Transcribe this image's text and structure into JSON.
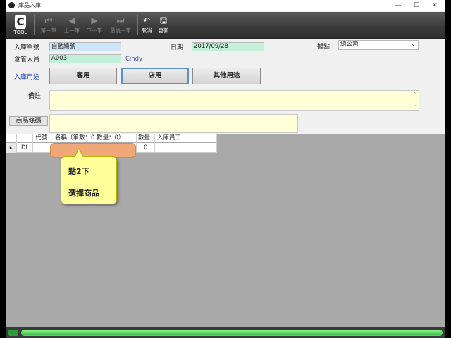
{
  "window": {
    "title": "庫品入庫",
    "minimize": "—",
    "maximize": "☐",
    "close": "✕"
  },
  "toolbar": {
    "logo_letter": "C",
    "logo_text": "TOOL",
    "buttons": [
      {
        "icon": "⏮",
        "label": "第一筆"
      },
      {
        "icon": "◀",
        "label": "上一筆"
      },
      {
        "icon": "▶",
        "label": "下一筆"
      },
      {
        "icon": "⏭",
        "label": "最後一筆"
      },
      {
        "icon": "↶",
        "label": "取消"
      },
      {
        "icon": "🖫",
        "label": "更新"
      }
    ]
  },
  "form": {
    "order_no_label": "入庫單號",
    "order_no_value": "自動編號",
    "date_label": "日期",
    "date_value": "2017/09/28",
    "location_label": "據點",
    "location_value": "總公司",
    "keeper_label": "倉管人員",
    "keeper_value": "A003",
    "keeper_name": "Cindy",
    "purpose_link": "入庫用途",
    "purpose_buttons": [
      "客用",
      "店用",
      "其他用途"
    ],
    "memo_label": "備註",
    "barcode_button": "商品條碼"
  },
  "grid": {
    "headers": [
      "代號",
      "名稱（筆數：0 數量：0）",
      "數量",
      "入庫員工"
    ],
    "row_marker": "▸",
    "rows": [
      {
        "code": "DL",
        "name": "",
        "qty": "0",
        "staff": ""
      }
    ]
  },
  "tooltip": {
    "line1": "點2下",
    "line2": "選擇商品"
  },
  "progress": {
    "fraction": 1.0
  }
}
